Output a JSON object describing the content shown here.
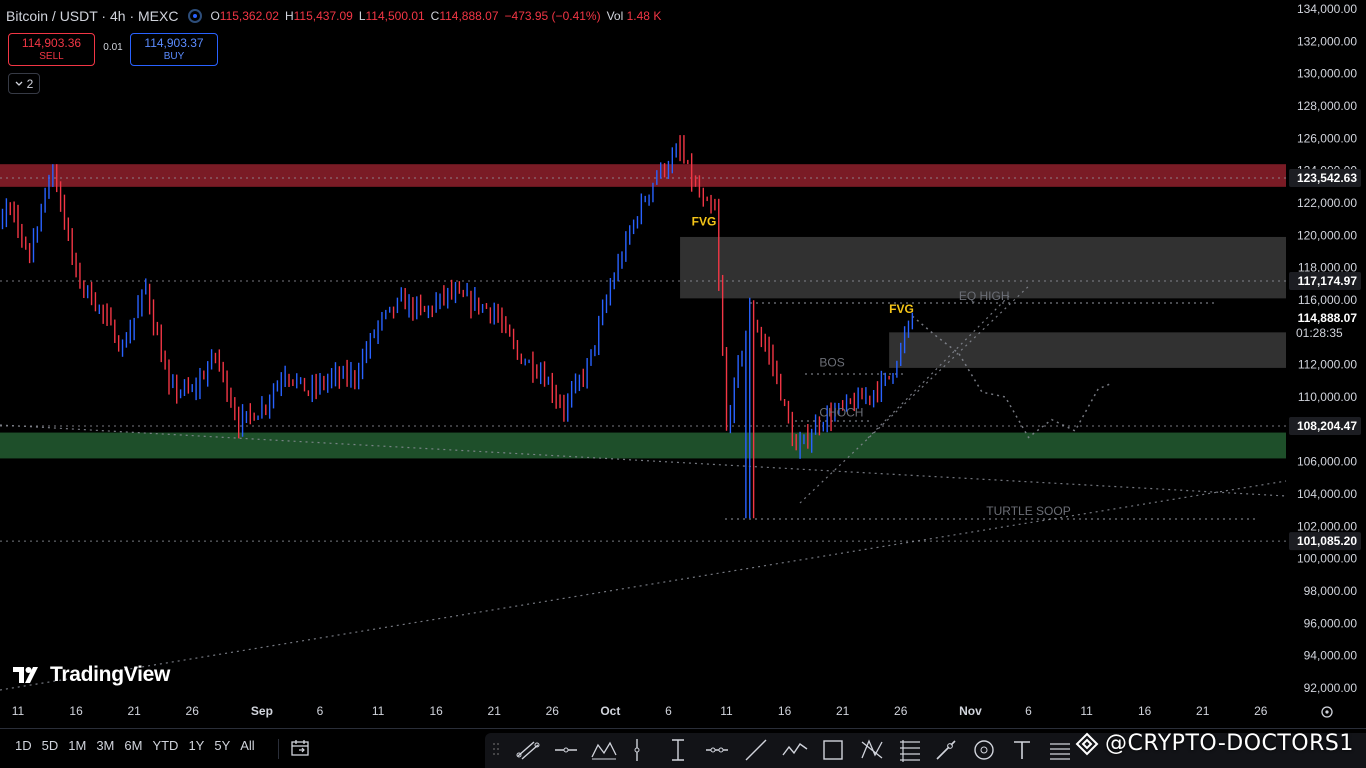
{
  "header": {
    "symbol": "Bitcoin / USDT · 4h · MEXC",
    "open_label": "O",
    "open": "115,362.02",
    "high_label": "H",
    "high": "115,437.09",
    "low_label": "L",
    "low": "114,500.01",
    "close_label": "C",
    "close": "114,888.07",
    "change": "−473.95 (−0.41%)",
    "vol_label": "Vol",
    "vol": "1.48 K"
  },
  "trade": {
    "sell_price": "114,903.36",
    "sell_label": "SELL",
    "spread": "0.01",
    "buy_price": "114,903.37",
    "buy_label": "BUY"
  },
  "indicators_toggle": "2",
  "logo": "TradingView",
  "timeframes": [
    "1D",
    "5D",
    "1M",
    "3M",
    "6M",
    "YTD",
    "1Y",
    "5Y",
    "All"
  ],
  "watermark": "@CRYPTO-DOCTORS1",
  "colors": {
    "bull": "#2962ff",
    "bear": "#f23645",
    "supply_zone": "#7a1b25",
    "demand_zone": "#1e4f2a",
    "fvg_box": "#3a3a3a",
    "fvg_label": "#f5c518"
  },
  "chart_data": {
    "type": "candlestick",
    "title": "Bitcoin / USDT · 4h · MEXC",
    "ylim": [
      91000,
      135000
    ],
    "y_ticks": [
      92000,
      94000,
      96000,
      98000,
      100000,
      102000,
      104000,
      106000,
      108000,
      110000,
      112000,
      114000,
      116000,
      118000,
      120000,
      122000,
      124000,
      126000,
      128000,
      130000,
      132000,
      134000
    ],
    "y_tick_labels": [
      "92,000.00",
      "94,000.00",
      "96,000.00",
      "98,000.00",
      "100,000.00",
      "102,000.00",
      "104,000.00",
      "106,000.00",
      "108,000.00",
      "110,000.00",
      "112,000.00",
      "114,000.00",
      "116,000.00",
      "118,000.00",
      "120,000.00",
      "122,000.00",
      "124,000.00",
      "126,000.00",
      "128,000.00",
      "130,000.00",
      "132,000.00",
      "134,000.00"
    ],
    "x_ticks": [
      {
        "label": "11",
        "date": "2025-08-11"
      },
      {
        "label": "16",
        "date": "2025-08-16"
      },
      {
        "label": "21",
        "date": "2025-08-21"
      },
      {
        "label": "26",
        "date": "2025-08-26"
      },
      {
        "label": "Sep",
        "date": "2025-09-01"
      },
      {
        "label": "6",
        "date": "2025-09-06"
      },
      {
        "label": "11",
        "date": "2025-09-11"
      },
      {
        "label": "16",
        "date": "2025-09-16"
      },
      {
        "label": "21",
        "date": "2025-09-21"
      },
      {
        "label": "26",
        "date": "2025-09-26"
      },
      {
        "label": "Oct",
        "date": "2025-10-01"
      },
      {
        "label": "6",
        "date": "2025-10-06"
      },
      {
        "label": "11",
        "date": "2025-10-11"
      },
      {
        "label": "16",
        "date": "2025-10-16"
      },
      {
        "label": "21",
        "date": "2025-10-21"
      },
      {
        "label": "26",
        "date": "2025-10-26"
      },
      {
        "label": "Nov",
        "date": "2025-11-01"
      },
      {
        "label": "6",
        "date": "2025-11-06"
      },
      {
        "label": "11",
        "date": "2025-11-11"
      },
      {
        "label": "16",
        "date": "2025-11-16"
      },
      {
        "label": "21",
        "date": "2025-11-21"
      },
      {
        "label": "26",
        "date": "2025-11-26"
      }
    ],
    "price_path": [
      {
        "date": "2025-08-08",
        "price": 116800
      },
      {
        "date": "2025-08-10",
        "price": 121800
      },
      {
        "date": "2025-08-12",
        "price": 119000
      },
      {
        "date": "2025-08-14",
        "price": 124300
      },
      {
        "date": "2025-08-16",
        "price": 117500
      },
      {
        "date": "2025-08-18",
        "price": 115500
      },
      {
        "date": "2025-08-20",
        "price": 113000
      },
      {
        "date": "2025-08-22",
        "price": 116800
      },
      {
        "date": "2025-08-24",
        "price": 110500
      },
      {
        "date": "2025-08-26",
        "price": 110300
      },
      {
        "date": "2025-08-28",
        "price": 112600
      },
      {
        "date": "2025-08-30",
        "price": 108400
      },
      {
        "date": "2025-09-01",
        "price": 109300
      },
      {
        "date": "2025-09-03",
        "price": 111600
      },
      {
        "date": "2025-09-05",
        "price": 110300
      },
      {
        "date": "2025-09-07",
        "price": 111200
      },
      {
        "date": "2025-09-09",
        "price": 111300
      },
      {
        "date": "2025-09-11",
        "price": 114500
      },
      {
        "date": "2025-09-13",
        "price": 115900
      },
      {
        "date": "2025-09-15",
        "price": 115200
      },
      {
        "date": "2025-09-17",
        "price": 116400
      },
      {
        "date": "2025-09-19",
        "price": 115900
      },
      {
        "date": "2025-09-21",
        "price": 115300
      },
      {
        "date": "2025-09-23",
        "price": 112600
      },
      {
        "date": "2025-09-25",
        "price": 111600
      },
      {
        "date": "2025-09-27",
        "price": 109300
      },
      {
        "date": "2025-09-29",
        "price": 111800
      },
      {
        "date": "2025-10-01",
        "price": 116800
      },
      {
        "date": "2025-10-03",
        "price": 120800
      },
      {
        "date": "2025-10-05",
        "price": 123800
      },
      {
        "date": "2025-10-07",
        "price": 125100
      },
      {
        "date": "2025-10-09",
        "price": 121900
      },
      {
        "date": "2025-10-10",
        "price": 121400
      },
      {
        "date": "2025-10-11",
        "price": 108100
      },
      {
        "date": "2025-10-12",
        "price": 111800
      },
      {
        "date": "2025-10-13",
        "price": 115300
      },
      {
        "date": "2025-10-15",
        "price": 112000
      },
      {
        "date": "2025-10-17",
        "price": 106600
      },
      {
        "date": "2025-10-19",
        "price": 108500
      },
      {
        "date": "2025-10-21",
        "price": 109300
      },
      {
        "date": "2025-10-23",
        "price": 110000
      },
      {
        "date": "2025-10-25",
        "price": 111200
      },
      {
        "date": "2025-10-27",
        "price": 114888
      }
    ],
    "candle_extremes": {
      "high": 126200,
      "low": 102500
    },
    "horizontal_levels": [
      {
        "price": 123542.63,
        "label": "123,542.63"
      },
      {
        "price": 117174.97,
        "label": "117,174.97"
      },
      {
        "price": 108204.47,
        "label": "108,204.47"
      },
      {
        "price": 101085.2,
        "label": "101,085.20"
      }
    ],
    "current_price": {
      "price": 114888.07,
      "label": "114,888.07",
      "countdown": "01:28:35"
    },
    "zones": [
      {
        "name": "supply",
        "from": 123000,
        "to": 124400
      },
      {
        "name": "demand",
        "from": 106200,
        "to": 107800
      },
      {
        "name": "fvg-upper",
        "from": 116100,
        "to": 119900,
        "start_date": "2025-10-07"
      },
      {
        "name": "fvg-lower",
        "from": 111800,
        "to": 114000,
        "start_date": "2025-10-25"
      }
    ],
    "annotations": [
      {
        "text": "FVG",
        "date": "2025-10-08",
        "price": 120600
      },
      {
        "text": "FVG",
        "date": "2025-10-25",
        "price": 115200
      },
      {
        "text": "EQ HIGH",
        "date": "2025-10-31",
        "price": 116000
      },
      {
        "text": "BOS",
        "date": "2025-10-19",
        "price": 111900
      },
      {
        "text": "CHOCH",
        "date": "2025-10-19",
        "price": 108800
      },
      {
        "text": "TURTLE SOOP",
        "date": "2025-11-06",
        "price": 102700
      }
    ],
    "projection": [
      {
        "date": "2025-10-27",
        "price": 115000
      },
      {
        "date": "2025-10-29",
        "price": 113800
      },
      {
        "date": "2025-10-31",
        "price": 112700
      },
      {
        "date": "2025-11-02",
        "price": 110300
      },
      {
        "date": "2025-11-04",
        "price": 110000
      },
      {
        "date": "2025-11-06",
        "price": 107500
      },
      {
        "date": "2025-11-08",
        "price": 108600
      },
      {
        "date": "2025-11-10",
        "price": 107900
      },
      {
        "date": "2025-11-12",
        "price": 110500
      },
      {
        "date": "2025-11-13",
        "price": 110800
      }
    ],
    "grid": false
  }
}
